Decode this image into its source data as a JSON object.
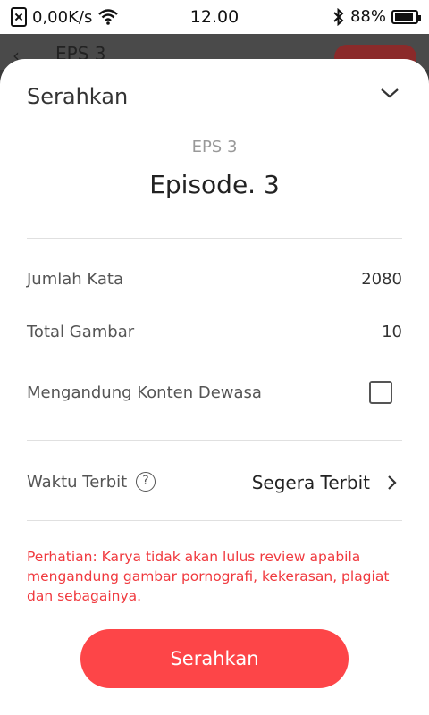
{
  "status_bar": {
    "speed": "0,00K/s",
    "time": "12.00",
    "battery": "88%",
    "icons": [
      "no-sim-icon",
      "wifi-icon",
      "bluetooth-icon",
      "battery-icon"
    ]
  },
  "background_header": {
    "title": "EPS 3"
  },
  "sheet": {
    "title": "Serahkan",
    "episode_label": "EPS 3",
    "episode_title": "Episode. 3",
    "rows": [
      {
        "label": "Jumlah Kata",
        "value": "2080"
      },
      {
        "label": "Total Gambar",
        "value": "10"
      }
    ],
    "adult_content_label": "Mengandung Konten Dewasa",
    "adult_content_checked": false,
    "publish_time_label": "Waktu Terbit",
    "publish_time_value": "Segera Terbit",
    "help_symbol": "?",
    "warning": "Perhatian: Karya tidak akan lulus review apabila mengandung gambar pornografi, kekerasan, plagiat dan sebagainya.",
    "submit_label": "Serahkan"
  },
  "colors": {
    "accent": "#fd4548",
    "warning_text": "#f0393e"
  }
}
